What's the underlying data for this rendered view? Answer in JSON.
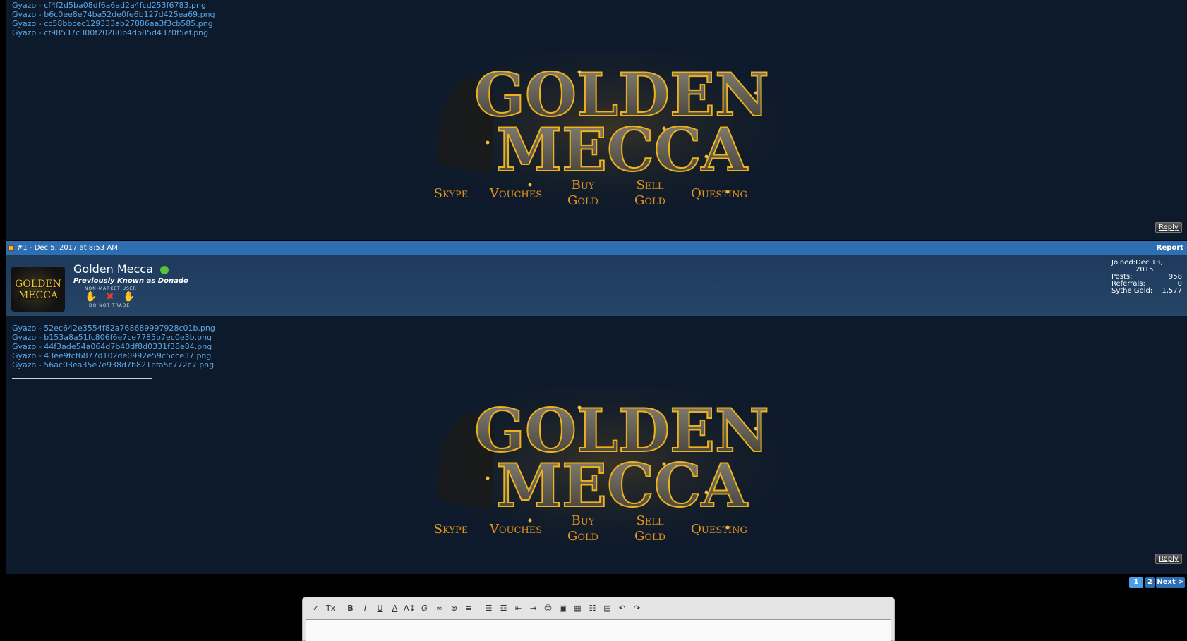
{
  "post_a": {
    "links": [
      "Gyazo - cf4f2d5ba08df6a6ad2a4fcd253f6783.png",
      "Gyazo - b6c0ee8e74ba52de0fe6b127d425ea69.png",
      "Gyazo - cc58bbcec129333ab27886aa3f3cb585.png",
      "Gyazo - cf98537c300f20280b4db85d4370f5ef.png"
    ],
    "reply_label": "Reply"
  },
  "banner": {
    "line1": "GOLDEN",
    "line2": "MECCA",
    "menu": [
      {
        "top": "Skype",
        "bottom": ""
      },
      {
        "top": "Vouches",
        "bottom": ""
      },
      {
        "top": "Buy",
        "bottom": "Gold"
      },
      {
        "top": "Sell",
        "bottom": "Gold"
      },
      {
        "top": "Questing",
        "bottom": ""
      }
    ],
    "colors": {
      "gold": "#f0b21a",
      "menu": "#e8931c"
    }
  },
  "post_header": {
    "meta": "#1 - Dec 5, 2017 at 8:53 AM",
    "report": "Report"
  },
  "user": {
    "name": "Golden Mecca",
    "title": "Previously Known as Donado",
    "avatar_text": [
      "GOLDEN",
      "MECCA"
    ],
    "badge_top": "NON-MARKET USER",
    "badge_bottom": "DO NOT TRADE",
    "status": "online",
    "stats": [
      {
        "label": "Joined:",
        "value": "Dec 13, 2015"
      },
      {
        "label": "Posts:",
        "value": "958"
      },
      {
        "label": "Referrals:",
        "value": "0"
      },
      {
        "label": "Sythe Gold:",
        "value": "1,577"
      }
    ]
  },
  "post_b": {
    "links": [
      "Gyazo - 52ec642e3554f82a768689997928c01b.png",
      "Gyazo - b153a8a51fc806f6e7ce7785b7ec0e3b.png",
      "Gyazo - 44f3ade54a064d7b40df8d0331f38e84.png",
      "Gyazo - 43ee9fcf6877d102de0992e59c5cce37.png",
      "Gyazo - 56ac03ea35e7e938d7b821bfa5c772c7.png"
    ],
    "reply_label": "Reply"
  },
  "pagination": {
    "pages": [
      "1",
      "2"
    ],
    "current": "1",
    "next": "Next >"
  },
  "toolbar": {
    "buttons": [
      "remove-format-icon",
      "clear-format-icon",
      "bold-icon",
      "italic-icon",
      "underline-icon",
      "text-color-icon",
      "font-size-icon",
      "font-family-icon",
      "link-icon",
      "unlink-icon",
      "align-icon",
      "bullet-list-icon",
      "number-list-icon",
      "outdent-icon",
      "indent-icon",
      "smilie-icon",
      "image-icon",
      "media-icon",
      "quote-icon",
      "save-draft-icon",
      "undo-icon",
      "redo-icon"
    ],
    "glyphs": {
      "bold": "B",
      "italic": "I",
      "underline": "U",
      "text_color": "A",
      "font_size": "A↕",
      "clear": "Tx"
    }
  }
}
